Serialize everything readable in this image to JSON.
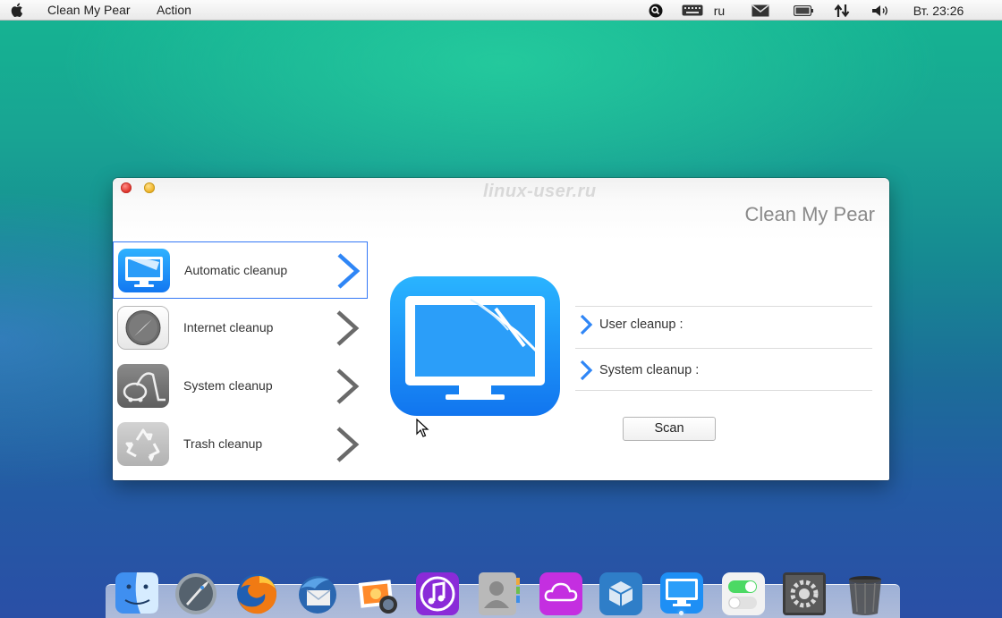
{
  "menubar": {
    "app_name": "Clean My Pear",
    "menu_action": "Action",
    "keyboard_layout": "ru",
    "clock": "Вт. 23:26",
    "icons": [
      "apple-icon",
      "search-icon",
      "keyboard-icon",
      "mail-icon",
      "battery-icon",
      "network-icon",
      "volume-icon"
    ]
  },
  "window": {
    "watermark": "linux-user.ru",
    "title": "Clean My Pear",
    "accent_color": "#3478f6",
    "sidebar": {
      "items": [
        {
          "label": "Automatic cleanup",
          "icon": "monitor-icon",
          "active": true
        },
        {
          "label": "Internet cleanup",
          "icon": "compass-icon",
          "active": false
        },
        {
          "label": "System cleanup",
          "icon": "vacuum-icon",
          "active": false
        },
        {
          "label": "Trash cleanup",
          "icon": "recycle-icon",
          "active": false
        }
      ]
    },
    "main": {
      "big_icon": "monitor-wiper-icon",
      "rows": [
        {
          "label": "User cleanup :"
        },
        {
          "label": "System cleanup :"
        }
      ],
      "scan_label": "Scan"
    }
  },
  "dock": {
    "items": [
      "finder-icon",
      "launchpad-icon",
      "firefox-icon",
      "thunderbird-icon",
      "photo-icon",
      "itunes-icon",
      "contacts-icon",
      "icloud-icon",
      "package-icon",
      "clean-my-pear-icon",
      "settings-toggle-icon",
      "system-prefs-icon",
      "trash-icon"
    ]
  }
}
